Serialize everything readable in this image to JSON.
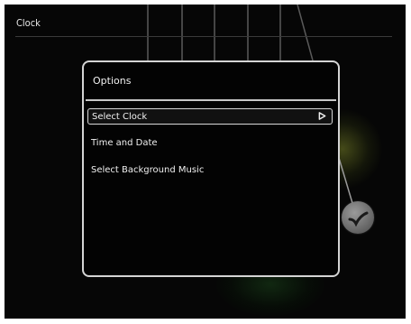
{
  "app": {
    "title": "Clock"
  },
  "dialog": {
    "title": "Options",
    "items": [
      {
        "label": "Select Clock",
        "selected": true,
        "icon": "play-arrow-icon"
      },
      {
        "label": "Time and Date",
        "selected": false
      },
      {
        "label": "Select Background Music",
        "selected": false
      }
    ]
  },
  "controls": {
    "ok_icon": "checkmark-icon"
  },
  "colors": {
    "background": "#060606",
    "text": "#f0f0f0",
    "border": "#d4d4d4",
    "ok_button": "#6a6a6a"
  }
}
